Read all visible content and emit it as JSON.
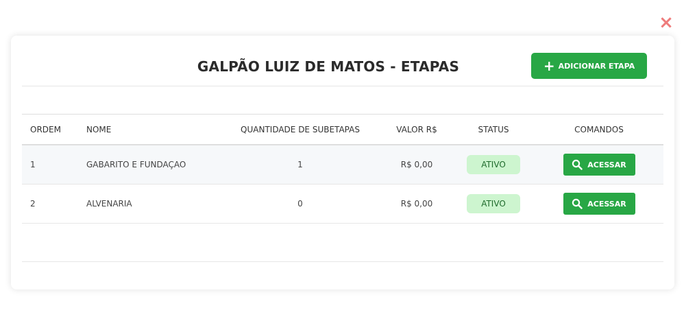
{
  "modal": {
    "title": "GALPÃO LUIZ DE MATOS - ETAPAS",
    "close_icon": "×",
    "add_button": {
      "icon": "plus-icon",
      "label": "ADICIONAR ETAPA"
    }
  },
  "table": {
    "headers": [
      "ORDEM",
      "NOME",
      "QUANTIDADE DE SUBETAPAS",
      "VALOR R$",
      "STATUS",
      "COMANDOS"
    ],
    "rows": [
      {
        "ordem": "1",
        "nome": "GABARITO E FUNDAÇAO",
        "qtd": "1",
        "valor": "R$ 0,00",
        "status": "ATIVO",
        "action": "ACESSAR"
      },
      {
        "ordem": "2",
        "nome": "ALVENARIA",
        "qtd": "0",
        "valor": "R$ 0,00",
        "status": "ATIVO",
        "action": "ACESSAR"
      }
    ]
  },
  "colors": {
    "accent": "#28a745",
    "status_bg": "#cdf5cf",
    "close": "#ee7b7b"
  }
}
